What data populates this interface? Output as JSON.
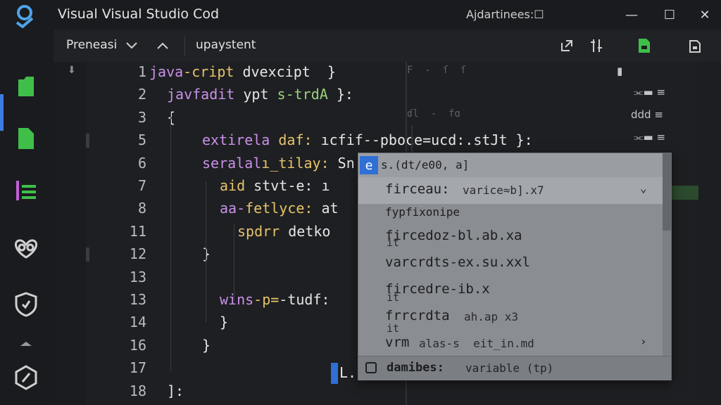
{
  "window": {
    "title": "Visual Visual Studio Cod",
    "right_label": "Ajdartinees:☐"
  },
  "tabbar": {
    "tab1_label": "Preneasi",
    "tab2_label": "upaystent"
  },
  "editor": {
    "line_numbers": [
      "1",
      "2",
      "3",
      "5",
      "6",
      "7",
      "8",
      "11",
      "12",
      "13",
      "13",
      "14",
      "16",
      "17",
      "18"
    ],
    "lines": [
      {
        "n": "1",
        "indent": 0,
        "parts": [
          {
            "t": "java",
            "c": "kw"
          },
          {
            "t": "-cript ",
            "c": "fn"
          },
          {
            "t": "dvexcipt  }",
            "c": "plain"
          }
        ]
      },
      {
        "n": "2",
        "indent": 1,
        "parts": [
          {
            "t": "javfadit ",
            "c": "kw"
          },
          {
            "t": "ypt ",
            "c": "plain"
          },
          {
            "t": "s-trdA ",
            "c": "str"
          },
          {
            "t": "}:",
            "c": "plain"
          }
        ]
      },
      {
        "n": "3",
        "indent": 1,
        "parts": [
          {
            "t": "{",
            "c": "plain"
          }
        ]
      },
      {
        "n": "5",
        "indent": 3,
        "parts": [
          {
            "t": "extirela ",
            "c": "kw"
          },
          {
            "t": "daf: ",
            "c": "fn"
          },
          {
            "t": "ıcfif--pboce=ucd:.stJt }:",
            "c": "plain"
          }
        ]
      },
      {
        "n": "6",
        "indent": 3,
        "parts": [
          {
            "t": "seralal",
            "c": "kw"
          },
          {
            "t": "ı_tilay: ",
            "c": "fn"
          },
          {
            "t": "Sn",
            "c": "plain"
          }
        ]
      },
      {
        "n": "7",
        "indent": 4,
        "parts": [
          {
            "t": "aid ",
            "c": "fn"
          },
          {
            "t": "stvt-e: ",
            "c": "plain"
          },
          {
            "t": "ı",
            "c": "plain"
          }
        ]
      },
      {
        "n": "8",
        "indent": 4,
        "parts": [
          {
            "t": "aa-",
            "c": "kw"
          },
          {
            "t": "fetlyce: ",
            "c": "fn"
          },
          {
            "t": "at",
            "c": "plain"
          }
        ]
      },
      {
        "n": "11",
        "indent": 5,
        "parts": [
          {
            "t": "spdrr ",
            "c": "fn"
          },
          {
            "t": "detko",
            "c": "plain"
          }
        ]
      },
      {
        "n": "12",
        "indent": 3,
        "parts": [
          {
            "t": "}",
            "c": "plain"
          }
        ]
      },
      {
        "n": "13",
        "indent": 0,
        "parts": []
      },
      {
        "n": "13",
        "indent": 4,
        "parts": [
          {
            "t": "wins",
            "c": "kw"
          },
          {
            "t": "-p=",
            "c": "fn"
          },
          {
            "t": "-tudf:",
            "c": "plain"
          }
        ]
      },
      {
        "n": "14",
        "indent": 4,
        "parts": [
          {
            "t": "}",
            "c": "plain"
          }
        ]
      },
      {
        "n": "16",
        "indent": 3,
        "parts": [
          {
            "t": "}",
            "c": "plain"
          }
        ]
      },
      {
        "n": "17",
        "indent": 0,
        "parts": []
      },
      {
        "n": "18",
        "indent": 1,
        "parts": [
          {
            "t": "]:",
            "c": "plain"
          }
        ]
      }
    ]
  },
  "minimap": {
    "row1": "F  -  ſ  ſ",
    "row2": "ɗl  -  fɑ",
    "icon1": "⏬",
    "icon2": "ddd≡",
    "icon3": "⏬"
  },
  "suggest": {
    "header_badge": "e",
    "header_text": "s.(dt/e00,  a]",
    "rows": [
      {
        "main": "firceau:",
        "detail": "varice≈b].x7",
        "selected": true,
        "chevron": "⌄"
      },
      {
        "main": "fypfixonipe",
        "detail": "",
        "selected": false,
        "chevron": ""
      },
      {
        "main": "fircedoz-bl.ab.xa",
        "detail": "",
        "selected": false,
        "chevron": ""
      },
      {
        "main": "varcrdts-ex.su.xxl",
        "detail": "",
        "selected": false,
        "chevron": ""
      },
      {
        "main": "fircedre-ib.x",
        "detail": "",
        "selected": false,
        "chevron": ""
      },
      {
        "main": "frrcrdta",
        "detail": "ah.ap x3",
        "selected": false,
        "chevron": ""
      },
      {
        "main": "vrm",
        "detail": "alas-s  eit_in.md",
        "selected": false,
        "chevron": "›"
      }
    ],
    "sub_labels": [
      "it",
      "it",
      "it"
    ],
    "footer_label": "damibes:",
    "footer_type": "variable (tp)"
  },
  "icons": {
    "activity": [
      "files-icon",
      "new-file-icon",
      "list-icon",
      "extensions-icon",
      "shield-icon",
      "arrow-icon",
      "settings-icon"
    ]
  },
  "colors": {
    "accent": "#3e7de0",
    "activity_green": "#3fbf4a",
    "keyword": "#c991e8",
    "function": "#e6c46a",
    "string": "#9bd27c"
  }
}
